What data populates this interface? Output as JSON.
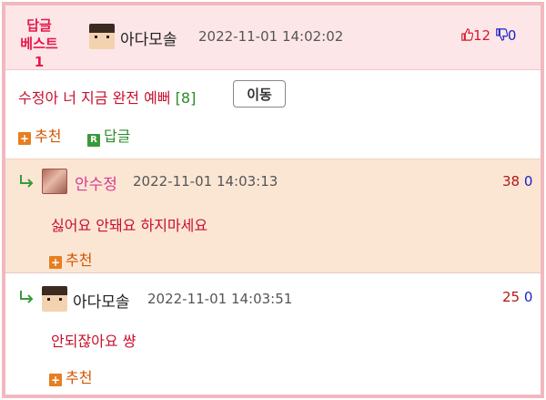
{
  "header": {
    "badge_line1": "답글",
    "badge_line2": "베스트1",
    "author": "아다모솔",
    "date": "2022-11-01 14:02:02",
    "up_count": "12",
    "down_count": "0"
  },
  "main_comment": {
    "text": "수정아 너 지금 완전 예뻐",
    "reply_count": "[8]",
    "move_label": "이동",
    "recommend_label": "추천",
    "reply_label": "답글"
  },
  "replies": [
    {
      "author": "안수정",
      "date": "2022-11-01 14:03:13",
      "up": "38",
      "down": "0",
      "text": "싫어요 안돼요 하지마세요",
      "recommend_label": "추천"
    },
    {
      "author": "아다모솔",
      "date": "2022-11-01 14:03:51",
      "up": "25",
      "down": "0",
      "text": "안되잖아요 썅",
      "recommend_label": "추천"
    }
  ],
  "colors": {
    "frame": "#f2b8bf",
    "header_bg": "#fde6e8",
    "highlight_bg": "#fbe6d4",
    "comment_text": "#c8102e",
    "recommend": "#d35400",
    "reply_green": "#2e8b2e",
    "up_vote": "#d11b2b",
    "down_vote": "#1a22c9"
  },
  "icons": {
    "thumbs_up": "thumbs-up-icon",
    "thumbs_down": "thumbs-down-icon",
    "plus_square": "plus-square-icon",
    "r_square": "reply-r-icon",
    "reply_arrow": "reply-arrow-icon"
  }
}
